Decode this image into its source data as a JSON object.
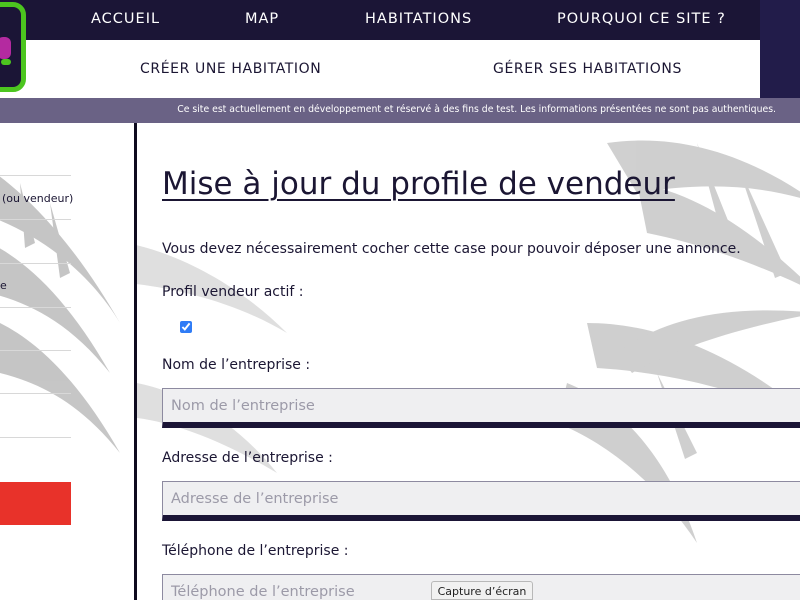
{
  "top_nav": {
    "items": [
      {
        "label": "ACCUEIL"
      },
      {
        "label": "MAP"
      },
      {
        "label": "HABITATIONS"
      },
      {
        "label": "POURQUOI CE SITE ?"
      }
    ]
  },
  "logo": {
    "icon": "brand-logo"
  },
  "sub_nav": {
    "items": [
      {
        "label": "CRÉER UNE HABITATION"
      },
      {
        "label": "GÉRER SES HABITATIONS"
      }
    ]
  },
  "notice": {
    "text": "Ce site est actuellement en développement et réservé à des fins de test. Les informations présentées ne sont pas authentiques."
  },
  "sidebar": {
    "items": [
      {
        "label": "(ou vendeur)"
      },
      {
        "label": "e"
      }
    ],
    "button_color": "#e8322a"
  },
  "main": {
    "title": "Mise à jour du profile de vendeur",
    "note": "Vous devez nécessairement cocher cette case pour pouvoir déposer une annonce.",
    "seller_active": {
      "label": "Profil vendeur actif :",
      "checked": true
    },
    "fields": [
      {
        "label": "Nom de l’entreprise :",
        "placeholder": "Nom de l’entreprise"
      },
      {
        "label": "Adresse de l’entreprise :",
        "placeholder": "Adresse de l’entreprise"
      },
      {
        "label": "Téléphone de l’entreprise :",
        "placeholder": "Téléphone de l’entreprise"
      }
    ]
  },
  "tooltip": {
    "text": "Capture d’écran"
  },
  "colors": {
    "nav_bg": "#1b1536",
    "notice_bg": "#6a6285",
    "accent_green": "#4cc51f",
    "field_bg": "#efeff1"
  }
}
